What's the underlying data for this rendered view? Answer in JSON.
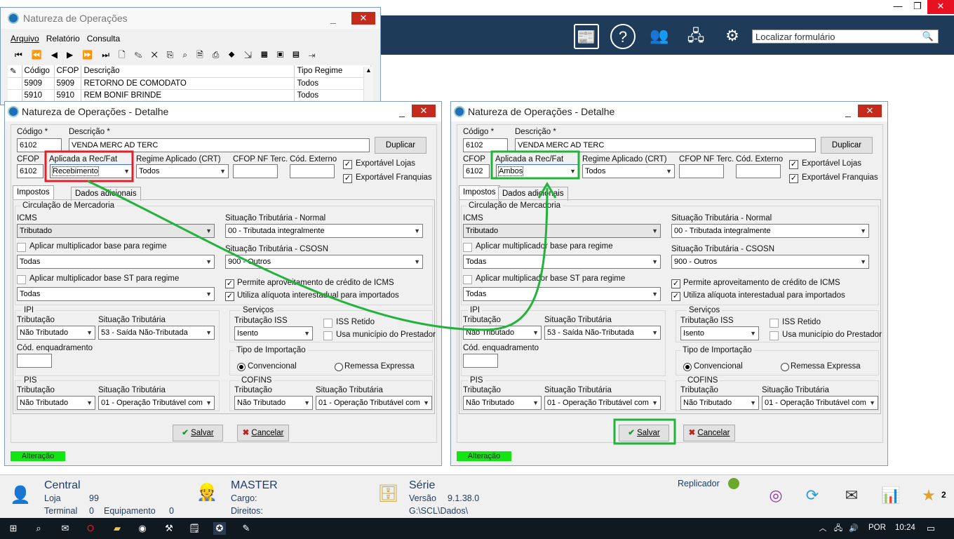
{
  "main_window": {
    "title": "Natureza de Operações",
    "menu": [
      "Arquivo",
      "Relatório",
      "Consulta"
    ],
    "grid": {
      "columns": [
        "Código",
        "CFOP",
        "Descrição",
        "Tipo Regime"
      ],
      "rows": [
        {
          "codigo": "5909",
          "cfop": "5909",
          "descricao": "RETORNO DE COMODATO",
          "tipo": "Todos"
        },
        {
          "codigo": "5910",
          "cfop": "5910",
          "descricao": "REM BONIF BRINDE",
          "tipo": "Todos"
        }
      ]
    }
  },
  "header": {
    "search_placeholder": "Localizar formulário"
  },
  "detail_left": {
    "title": "Natureza de Operações - Detalhe",
    "codigo_label": "Código *",
    "codigo": "6102",
    "descricao_label": "Descrição *",
    "descricao": "VENDA MERC AD TERC",
    "duplicar": "Duplicar",
    "cfop_label": "CFOP",
    "cfop": "6102",
    "aplicada_label": "Aplicada a Rec/Fat",
    "aplicada": "Recebimento",
    "regime_label": "Regime Aplicado (CRT)",
    "regime": "Todos",
    "cfop_nf_label": "CFOP NF Terc.",
    "cod_externo_label": "Cód. Externo",
    "exportavel_lojas": "Exportável Lojas",
    "exportavel_franquias": "Exportável Franquias",
    "tab_impostos": "Impostos",
    "tab_dados": "Dados adicionais",
    "circulacao": "Circulação de Mercadoria",
    "icms_label": "ICMS",
    "icms": "Tributado",
    "sit_normal_label": "Situação Tributária - Normal",
    "sit_normal": "00 - Tributada integralmente",
    "aplicar_mult": "Aplicar multiplicador base para regime",
    "aplicar_mult_val": "Todas",
    "sit_csosn_label": "Situação Tributária - CSOSN",
    "sit_csosn": "900 - Outros",
    "aplicar_mult_st": "Aplicar multiplicador base ST para regime",
    "aplicar_mult_st_val": "Todas",
    "permite_credito": "Permite aproveitamento de crédito de ICMS",
    "utiliza_aliquota": "Utiliza alíquota interestadual para importados",
    "ipi": "IPI",
    "ipi_trib_label": "Tributação",
    "ipi_trib": "Não Tributado",
    "ipi_sit_label": "Situação Tributária",
    "ipi_sit": "53 - Saída Não-Tributada",
    "cod_enq_label": "Cód. enquadramento",
    "servicos": "Serviços",
    "iss_label": "Tributação ISS",
    "iss": "Isento",
    "iss_retido": "ISS Retido",
    "usa_municipio": "Usa município do Prestador",
    "tipo_import": "Tipo de Importação",
    "convencional": "Convencional",
    "remessa": "Remessa Expressa",
    "pis": "PIS",
    "pis_trib_label": "Tributação",
    "pis_trib": "Não Tributado",
    "pis_sit_label": "Situação Tributária",
    "pis_sit": "01 - Operação Tributável com",
    "cofins": "COFINS",
    "cofins_trib_label": "Tributação",
    "cofins_trib": "Não Tributado",
    "cofins_sit_label": "Situação Tributária",
    "cofins_sit": "01 - Operação Tributável com",
    "salvar": "Salvar",
    "cancelar": "Cancelar",
    "status": "Alteração"
  },
  "detail_right": {
    "title": "Natureza de Operações - Detalhe",
    "codigo_label": "Código *",
    "codigo": "6102",
    "descricao_label": "Descrição *",
    "descricao": "VENDA MERC AD TERC",
    "duplicar": "Duplicar",
    "cfop_label": "CFOP",
    "cfop": "6102",
    "aplicada_label": "Aplicada a Rec/Fat",
    "aplicada": "Ambos",
    "regime_label": "Regime Aplicado (CRT)",
    "regime": "Todos",
    "cfop_nf_label": "CFOP NF Terc.",
    "cod_externo_label": "Cód. Externo",
    "exportavel_lojas": "Exportável Lojas",
    "exportavel_franquias": "Exportável Franquias",
    "tab_impostos": "Impostos",
    "tab_dados": "Dados adicionais",
    "circulacao": "Circulação de Mercadoria",
    "icms_label": "ICMS",
    "icms": "Tributado",
    "sit_normal_label": "Situação Tributária - Normal",
    "sit_normal": "00 - Tributada integralmente",
    "aplicar_mult": "Aplicar multiplicador base para regime",
    "aplicar_mult_val": "Todas",
    "sit_csosn_label": "Situação Tributária - CSOSN",
    "sit_csosn": "900 - Outros",
    "aplicar_mult_st": "Aplicar multiplicador base ST para regime",
    "aplicar_mult_st_val": "Todas",
    "permite_credito": "Permite aproveitamento de crédito de ICMS",
    "utiliza_aliquota": "Utiliza alíquota interestadual para importados",
    "ipi": "IPI",
    "ipi_trib_label": "Tributação",
    "ipi_trib": "Não Tributado",
    "ipi_sit_label": "Situação Tributária",
    "ipi_sit": "53 - Saída Não-Tributada",
    "cod_enq_label": "Cód. enquadramento",
    "servicos": "Serviços",
    "iss_label": "Tributação ISS",
    "iss": "Isento",
    "iss_retido": "ISS Retido",
    "usa_municipio": "Usa município do Prestador",
    "tipo_import": "Tipo de Importação",
    "convencional": "Convencional",
    "remessa": "Remessa Expressa",
    "pis": "PIS",
    "pis_trib_label": "Tributação",
    "pis_trib": "Não Tributado",
    "pis_sit_label": "Situação Tributária",
    "pis_sit": "01 - Operação Tributável com",
    "cofins": "COFINS",
    "cofins_trib_label": "Tributação",
    "cofins_trib": "Não Tributado",
    "cofins_sit_label": "Situação Tributária",
    "cofins_sit": "01 - Operação Tributável com",
    "salvar": "Salvar",
    "cancelar": "Cancelar",
    "status": "Alteração"
  },
  "bottom": {
    "central": "Central",
    "loja_label": "Loja",
    "loja": "99",
    "terminal_label": "Terminal",
    "terminal": "0",
    "equipamento_label": "Equipamento",
    "equipamento": "0",
    "user": "MASTER",
    "cargo_label": "Cargo:",
    "direitos_label": "Direitos:",
    "serie": "Série",
    "versao_label": "Versão",
    "versao": "9.1.38.0",
    "path": "G:\\SCL\\Dados\\",
    "replicador": "Replicador",
    "notif_count": "2"
  },
  "taskbar": {
    "lang": "POR",
    "time": "10:24"
  },
  "colors": {
    "highlight_red": "#e0202a",
    "highlight_green": "#22b33a",
    "header_bg": "#1e3b5a",
    "status_green": "#12e612"
  }
}
